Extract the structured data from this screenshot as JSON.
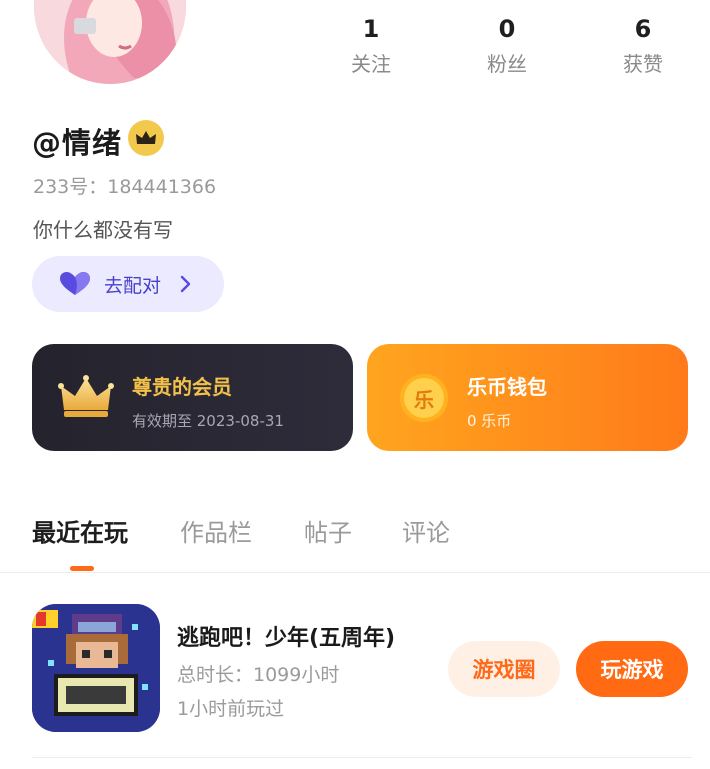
{
  "profile": {
    "username": "@情绪",
    "user_id": "233号：184441366",
    "bio": "你什么都没有写",
    "match_label": "去配对"
  },
  "stats": [
    {
      "value": "1",
      "label": "关注"
    },
    {
      "value": "0",
      "label": "粉丝"
    },
    {
      "value": "6",
      "label": "获赞"
    }
  ],
  "cards": {
    "vip": {
      "title": "尊贵的会员",
      "subtitle": "有效期至 2023-08-31"
    },
    "wallet": {
      "title": "乐币钱包",
      "subtitle": "0 乐币",
      "coin_glyph": "乐"
    }
  },
  "tabs": [
    {
      "label": "最近在玩",
      "active": true
    },
    {
      "label": "作品栏",
      "active": false
    },
    {
      "label": "帖子",
      "active": false
    },
    {
      "label": "评论",
      "active": false
    }
  ],
  "game": {
    "title": "逃跑吧！少年(五周年)",
    "total_time": "总时长：1099小时",
    "last_played": "1小时前玩过",
    "circle_button": "游戏圈",
    "play_button": "玩游戏"
  },
  "icons": {
    "crown": "crown-icon",
    "heart": "heart-icon",
    "chevron": "chevron-right-icon",
    "coin": "coin-icon"
  },
  "colors": {
    "accent": "#ff6a18",
    "match_bg": "#ebeaff",
    "match_text": "#4a3fc9",
    "vip_bg": "#24232d",
    "vip_title": "#f3c14b",
    "wallet_bg": "#ff8e1d"
  }
}
